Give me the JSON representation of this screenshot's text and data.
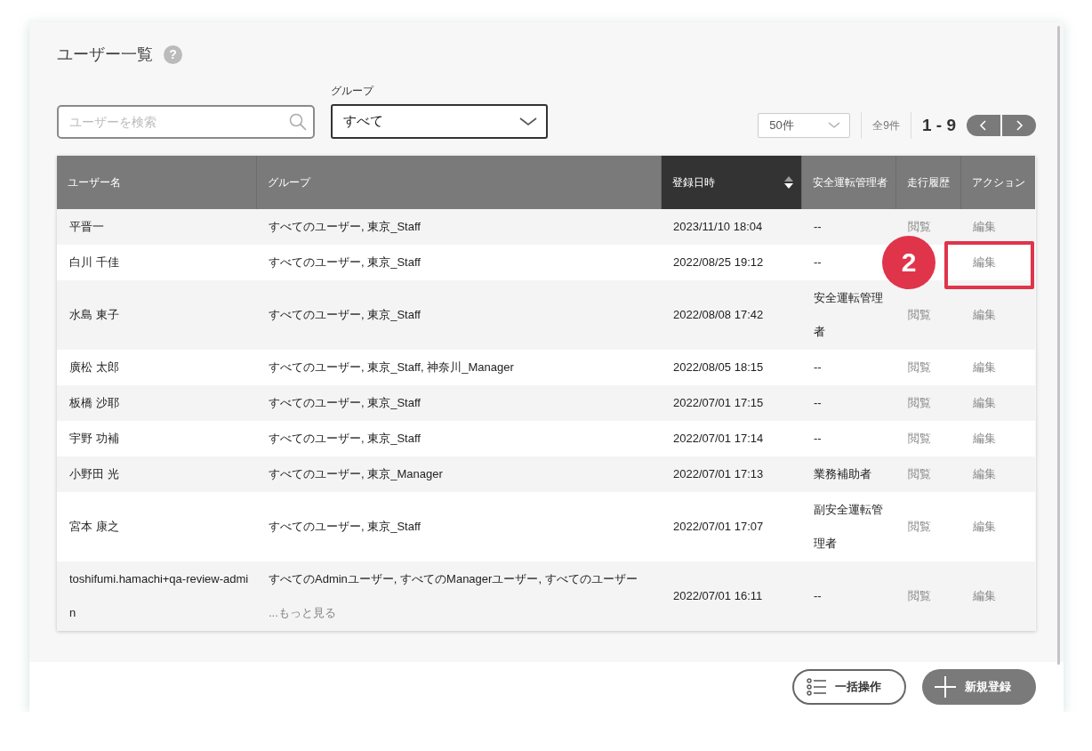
{
  "page": {
    "title": "ユーザー一覧",
    "help": "?"
  },
  "filters": {
    "search": {
      "placeholder": "ユーザーを検索"
    },
    "group": {
      "label": "グループ",
      "value": "すべて"
    }
  },
  "pagination": {
    "per_page": "50件",
    "total": "全9件",
    "range": "1 - 9"
  },
  "table": {
    "columns": [
      {
        "label": "ユーザー名",
        "sorted": false
      },
      {
        "label": "グループ",
        "sorted": false
      },
      {
        "label": "登録日時",
        "sorted": true
      },
      {
        "label": "安全運転管理者",
        "sorted": false
      },
      {
        "label": "走行履歴",
        "sorted": false
      },
      {
        "label": "アクション",
        "sorted": false
      }
    ],
    "rows": [
      {
        "name": "平晋一",
        "groups": "すべてのユーザー, 東京_Staff",
        "registered": "2023/11/10 18:04",
        "safety": "--",
        "history": "閲覧",
        "action": "編集"
      },
      {
        "name": "白川 千佳",
        "groups": "すべてのユーザー, 東京_Staff",
        "registered": "2022/08/25 19:12",
        "safety": "--",
        "action": "編集",
        "annotation": {
          "number": "2",
          "highlight": true
        }
      },
      {
        "name": "水島 東子",
        "groups": "すべてのユーザー, 東京_Staff",
        "registered": "2022/08/08 17:42",
        "safety": "安全運転管理者",
        "history": "閲覧",
        "action": "編集"
      },
      {
        "name": "廣松 太郎",
        "groups": "すべてのユーザー, 東京_Staff, 神奈川_Manager",
        "registered": "2022/08/05 18:15",
        "safety": "--",
        "history": "閲覧",
        "action": "編集"
      },
      {
        "name": "板橋 沙耶",
        "groups": "すべてのユーザー, 東京_Staff",
        "registered": "2022/07/01 17:15",
        "safety": "--",
        "history": "閲覧",
        "action": "編集"
      },
      {
        "name": "宇野 功補",
        "groups": "すべてのユーザー, 東京_Staff",
        "registered": "2022/07/01 17:14",
        "safety": "--",
        "history": "閲覧",
        "action": "編集"
      },
      {
        "name": "小野田 光",
        "groups": "すべてのユーザー, 東京_Manager",
        "registered": "2022/07/01 17:13",
        "safety": "業務補助者",
        "history": "閲覧",
        "action": "編集"
      },
      {
        "name": "宮本 康之",
        "groups": "すべてのユーザー, 東京_Staff",
        "registered": "2022/07/01 17:07",
        "safety": "副安全運転管理者",
        "history": "閲覧",
        "action": "編集"
      },
      {
        "name": "toshifumi.hamachi+qa-review-admin",
        "groups": "すべてのAdminユーザー, すべてのManagerユーザー, すべてのユーザー",
        "more": "...もっと見る",
        "registered": "2022/07/01 16:11",
        "safety": "--",
        "history": "閲覧",
        "action": "編集"
      }
    ]
  },
  "footer": {
    "buttons": [
      {
        "label": "一括操作",
        "kind": "outline"
      },
      {
        "label": "新規登録",
        "kind": "filled"
      }
    ]
  }
}
